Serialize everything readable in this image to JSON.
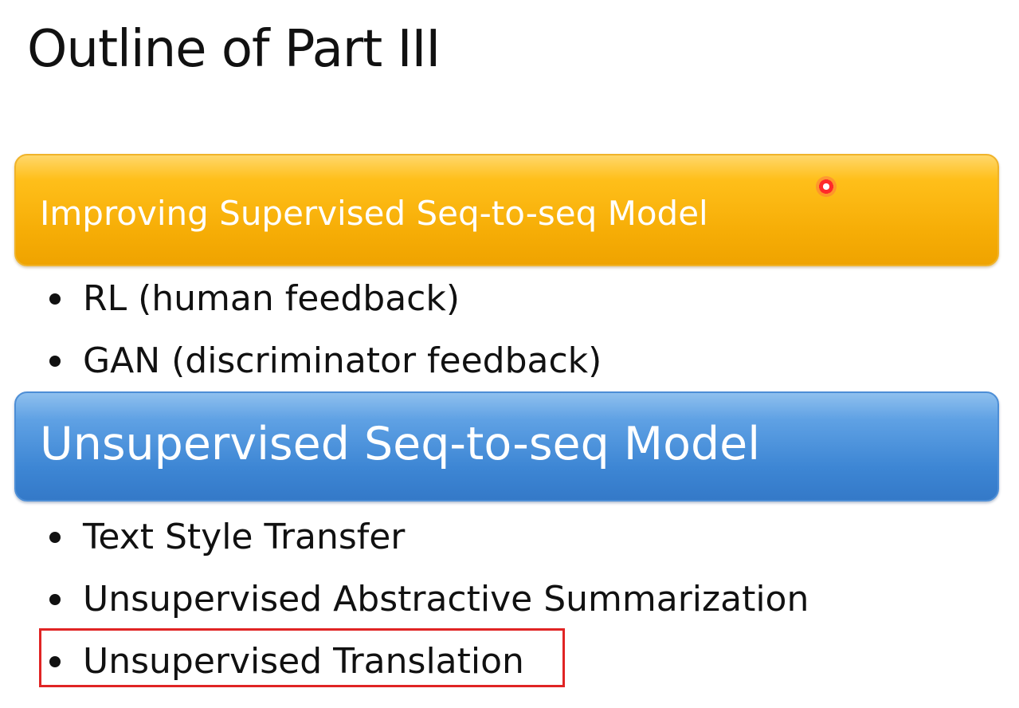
{
  "slide": {
    "title": "Outline of Part III"
  },
  "sections": [
    {
      "heading": "Improving Supervised Seq-to-seq Model",
      "color": "#f6ad06",
      "items": [
        "RL (human feedback)",
        "GAN (discriminator feedback)"
      ]
    },
    {
      "heading": "Unsupervised Seq-to-seq Model",
      "color": "#3d86d4",
      "items": [
        "Text Style Transfer",
        "Unsupervised Abstractive Summarization",
        "Unsupervised Translation"
      ]
    }
  ],
  "highlight": {
    "item": "Unsupervised Translation",
    "color": "#e02424"
  },
  "icons": {
    "pointer": "laser-pointer-icon",
    "bullet": "bullet-dot-icon"
  }
}
